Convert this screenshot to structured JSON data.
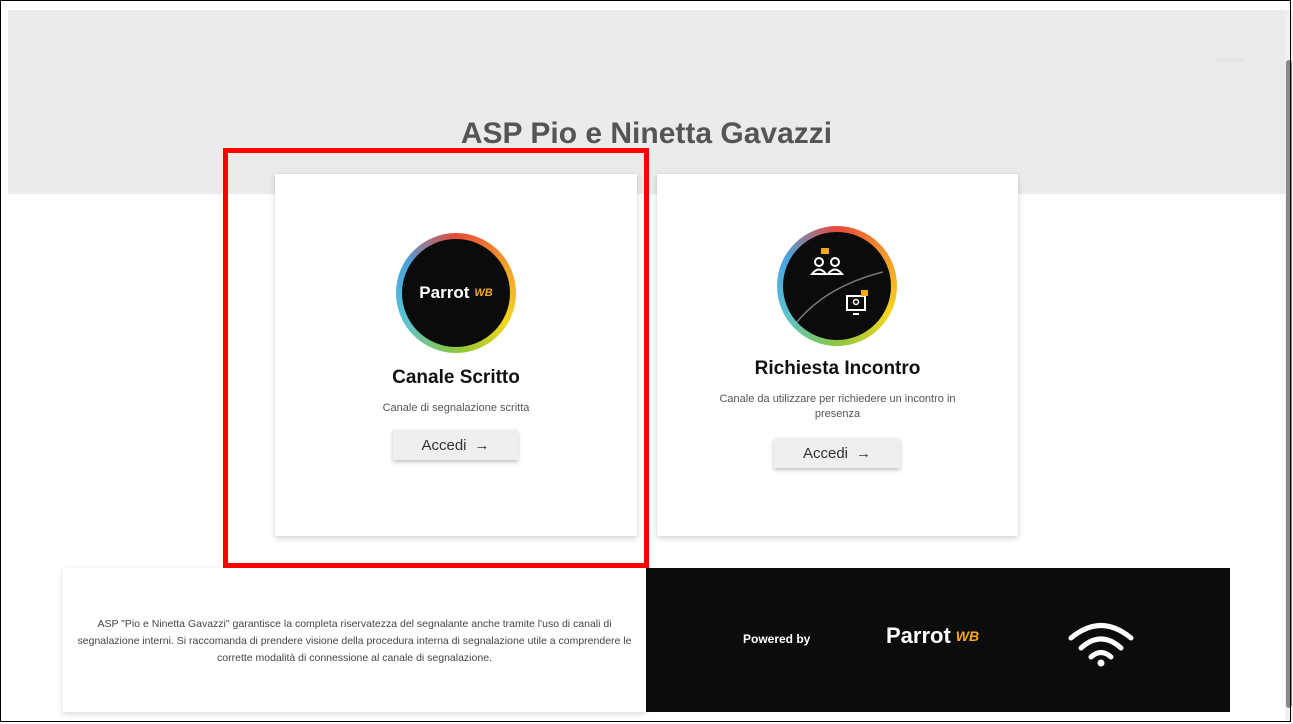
{
  "page": {
    "title": "ASP Pio e Ninetta Gavazzi"
  },
  "cards": [
    {
      "logo_text": "Parrot",
      "logo_mark": "WB",
      "title": "Canale Scritto",
      "description": "Canale di segnalazione scritta",
      "button_label": "Accedi",
      "button_icon": "→"
    },
    {
      "logo_icon": "meeting-icon",
      "title": "Richiesta Incontro",
      "description": "Canale da utilizzare per richiedere un incontro in presenza",
      "button_label": "Accedi",
      "button_icon": "→"
    }
  ],
  "footer": {
    "privacy_text": "ASP \"Pio e Ninetta Gavazzi\" garantisce la completa riservatezza del segnalante anche tramite l'uso di canali di segnalazione interni. Si raccomanda di prendere visione della procedura interna di segnalazione utile a comprendere le corrette modalità di connessione al canale di segnalazione.",
    "powered_by": "Powered by",
    "brand_text": "Parrot",
    "brand_mark": "WB"
  },
  "colors": {
    "header_band": "#ebebeb",
    "highlight": "#ff0000",
    "footer_dark": "#0c0c0c"
  }
}
